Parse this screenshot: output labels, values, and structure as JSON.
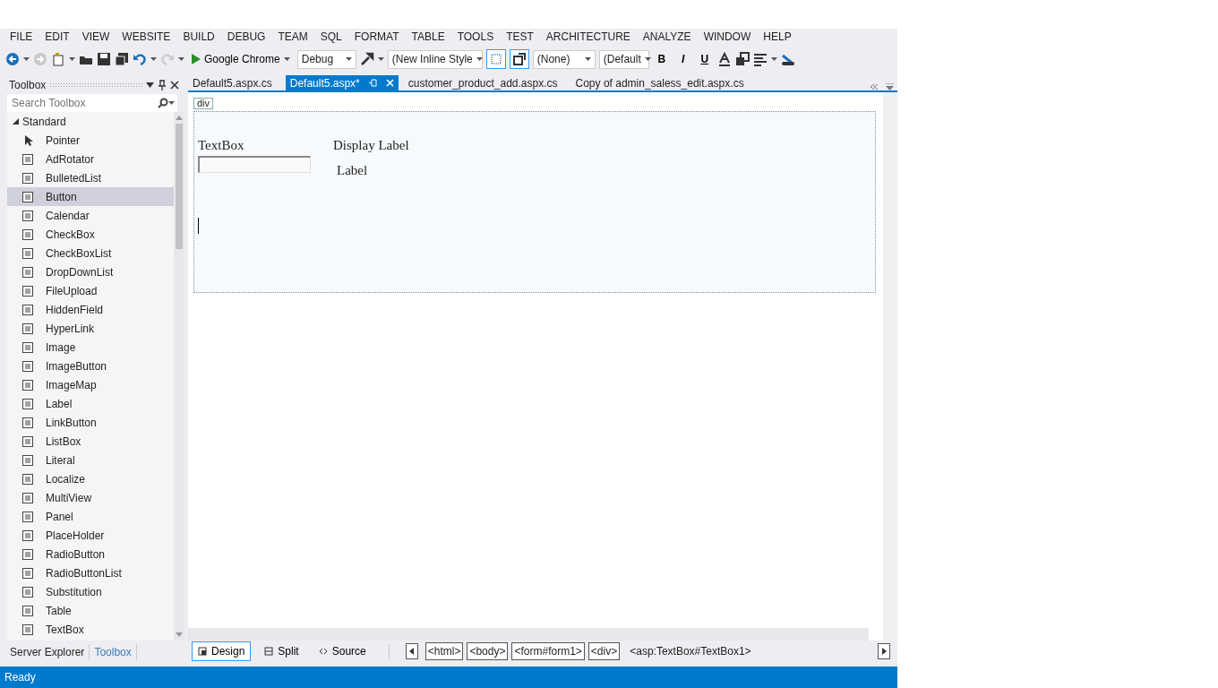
{
  "menu": [
    "FILE",
    "EDIT",
    "VIEW",
    "WEBSITE",
    "BUILD",
    "DEBUG",
    "TEAM",
    "SQL",
    "FORMAT",
    "TABLE",
    "TOOLS",
    "TEST",
    "ARCHITECTURE",
    "ANALYZE",
    "WINDOW",
    "HELP"
  ],
  "toolbar": {
    "run_target": "Google Chrome",
    "configuration": "Debug",
    "style": "(New Inline Style",
    "target_rule": "(None)",
    "font": "(Default",
    "bold": "B",
    "italic": "I",
    "underline": "U",
    "toggles": [
      {
        "selected": true
      },
      {
        "selected": true
      }
    ]
  },
  "toolbox": {
    "title": "Toolbox",
    "search_placeholder": "Search Toolbox",
    "group": {
      "label": "Standard",
      "expanded": true,
      "items": [
        {
          "label": "Pointer",
          "selected": false
        },
        {
          "label": "AdRotator",
          "selected": false
        },
        {
          "label": "BulletedList",
          "selected": false
        },
        {
          "label": "Button",
          "selected": true
        },
        {
          "label": "Calendar",
          "selected": false
        },
        {
          "label": "CheckBox",
          "selected": false
        },
        {
          "label": "CheckBoxList",
          "selected": false
        },
        {
          "label": "DropDownList",
          "selected": false
        },
        {
          "label": "FileUpload",
          "selected": false
        },
        {
          "label": "HiddenField",
          "selected": false
        },
        {
          "label": "HyperLink",
          "selected": false
        },
        {
          "label": "Image",
          "selected": false
        },
        {
          "label": "ImageButton",
          "selected": false
        },
        {
          "label": "ImageMap",
          "selected": false
        },
        {
          "label": "Label",
          "selected": false
        },
        {
          "label": "LinkButton",
          "selected": false
        },
        {
          "label": "ListBox",
          "selected": false
        },
        {
          "label": "Literal",
          "selected": false
        },
        {
          "label": "Localize",
          "selected": false
        },
        {
          "label": "MultiView",
          "selected": false
        },
        {
          "label": "Panel",
          "selected": false
        },
        {
          "label": "PlaceHolder",
          "selected": false
        },
        {
          "label": "RadioButton",
          "selected": false
        },
        {
          "label": "RadioButtonList",
          "selected": false
        },
        {
          "label": "Substitution",
          "selected": false
        },
        {
          "label": "Table",
          "selected": false
        },
        {
          "label": "TextBox",
          "selected": false
        }
      ]
    }
  },
  "panel_tabs": [
    {
      "label": "Server Explorer",
      "selected": false
    },
    {
      "label": "Toolbox",
      "selected": true
    }
  ],
  "document_tabs": [
    {
      "label": "Default5.aspx.cs",
      "selected": false
    },
    {
      "label": "Default5.aspx*",
      "selected": true
    },
    {
      "label": "customer_product_add.aspx.cs",
      "selected": false
    },
    {
      "label": "Copy of admin_saless_edit.aspx.cs",
      "selected": false
    }
  ],
  "designer": {
    "tag": "div",
    "textbox_caption": "TextBox",
    "display_label": "Display Label",
    "label": "Label"
  },
  "view_tabs": [
    {
      "label": "Design",
      "selected": true
    },
    {
      "label": "Split",
      "selected": false
    },
    {
      "label": "Source",
      "selected": false
    }
  ],
  "breadcrumb": [
    {
      "label": "<html>",
      "selected": false
    },
    {
      "label": "<body>",
      "selected": false
    },
    {
      "label": "<form#form1>",
      "selected": false
    },
    {
      "label": "<div>",
      "selected": false
    },
    {
      "label": "<asp:TextBox#TextBox1>",
      "selected": true
    }
  ],
  "status_bar": {
    "text": "Ready"
  }
}
